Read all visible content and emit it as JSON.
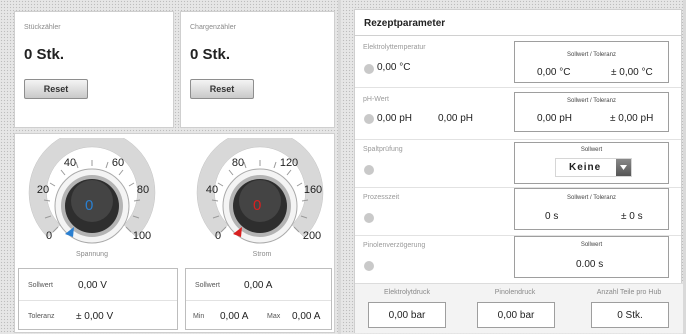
{
  "counters": [
    {
      "label": "Stückzähler",
      "value": "0 Stk.",
      "reset_label": "Reset"
    },
    {
      "label": "Chargenzähler",
      "value": "0 Stk.",
      "reset_label": "Reset"
    }
  ],
  "gauges": {
    "voltage": {
      "ticks": [
        "0",
        "20",
        "40",
        "60",
        "80",
        "100"
      ],
      "value": "0",
      "caption": "Spannung",
      "indicator_color": "#2a7fd0",
      "needle_value": 0,
      "setpoint_label": "Sollwert",
      "setpoint_value": "0,00 V",
      "tolerance_label": "Toleranz",
      "tolerance_value": "± 0,00 V"
    },
    "current": {
      "ticks": [
        "0",
        "40",
        "80",
        "120",
        "160",
        "200"
      ],
      "value": "0",
      "caption": "Strom",
      "indicator_color": "#d82020",
      "needle_value": 0,
      "setpoint_label": "Sollwert",
      "setpoint_value": "0,00 A",
      "min_label": "Min",
      "min_value": "0,00 A",
      "max_label": "Max",
      "max_value": "0,00 A"
    }
  },
  "recipe": {
    "title": "Rezeptparameter",
    "rows": [
      {
        "label": "Elektrolyttemperatur",
        "actual": "0,00 °C",
        "box_caption": "Sollwert / Toleranz",
        "setpoint": "0,00 °C",
        "tolerance": "± 0,00 °C"
      },
      {
        "label": "pH-Wert",
        "actual": "0,00 pH",
        "actual2": "0,00 pH",
        "box_caption": "Sollwert / Toleranz",
        "setpoint": "0,00 pH",
        "tolerance": "± 0,00 pH"
      },
      {
        "label": "Spaltprüfung",
        "box_caption": "Sollwert",
        "select_value": "Keine"
      },
      {
        "label": "Prozesszeit",
        "box_caption": "Sollwert / Toleranz",
        "setpoint": "0 s",
        "tolerance": "± 0 s"
      },
      {
        "label": "Pinolenverzögerung",
        "box_caption": "Sollwert",
        "setpoint": "0.00 s"
      }
    ],
    "bottom": [
      {
        "label": "Elektrolytdruck",
        "value": "0,00 bar"
      },
      {
        "label": "Pinolendruck",
        "value": "0,00 bar"
      },
      {
        "label": "Anzahl Teile pro Hub",
        "value": "0 Stk."
      }
    ]
  },
  "colors": {
    "status_indicator": "#c9c9c9"
  }
}
